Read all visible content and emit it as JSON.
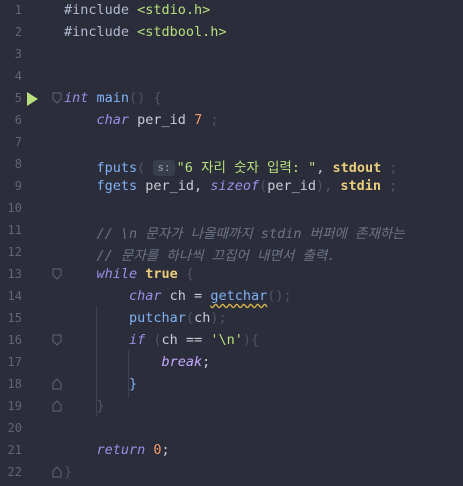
{
  "editor": {
    "lines": [
      {
        "n": "1",
        "parts": [
          {
            "t": "#include ",
            "c": "inc"
          },
          {
            "t": "<stdio.h>",
            "c": "str"
          }
        ]
      },
      {
        "n": "2",
        "parts": [
          {
            "t": "#include ",
            "c": "inc"
          },
          {
            "t": "<stdbool.h>",
            "c": "str"
          }
        ]
      },
      {
        "n": "3",
        "parts": []
      },
      {
        "n": "4",
        "parts": []
      },
      {
        "n": "5",
        "parts": [
          {
            "t": "int",
            "c": "kw"
          },
          {
            "t": " main",
            "c": "fn"
          },
          {
            "t": "() {",
            "c": "paren"
          }
        ]
      },
      {
        "n": "6",
        "parts": [
          {
            "t": "    char",
            "c": "kw"
          },
          {
            "t": " per_id ",
            "c": ""
          },
          {
            "t": "7",
            "c": "num"
          },
          {
            "t": " ;",
            "c": "paren"
          }
        ]
      },
      {
        "n": "7",
        "parts": []
      },
      {
        "n": "8",
        "parts": [
          {
            "t": "    fputs",
            "c": "fn"
          },
          {
            "t": "( ",
            "c": "paren"
          },
          {
            "t": "s:",
            "c": "hint"
          },
          {
            "t": "\"6 자리 숫자 입력: \"",
            "c": "str"
          },
          {
            "t": ", ",
            "c": ""
          },
          {
            "t": "stdout",
            "c": "bold"
          },
          {
            "t": " ;",
            "c": "paren"
          }
        ]
      },
      {
        "n": "9",
        "parts": [
          {
            "t": "    fgets",
            "c": "fn"
          },
          {
            "t": " per_id, ",
            "c": ""
          },
          {
            "t": "sizeof",
            "c": "kw"
          },
          {
            "t": "(",
            "c": "paren"
          },
          {
            "t": "per_id",
            "c": ""
          },
          {
            "t": "), ",
            "c": "paren"
          },
          {
            "t": "stdin",
            "c": "bold"
          },
          {
            "t": " ;",
            "c": "paren"
          }
        ]
      },
      {
        "n": "10",
        "parts": []
      },
      {
        "n": "11",
        "parts": [
          {
            "t": "    // \\n 문자가 나올때까지 stdin 버퍼에 존재하는",
            "c": "cmt"
          }
        ]
      },
      {
        "n": "12",
        "parts": [
          {
            "t": "    // 문자를 하나씩 끄집어 내면서 출력.",
            "c": "cmt"
          }
        ]
      },
      {
        "n": "13",
        "parts": [
          {
            "t": "    while",
            "c": "kw"
          },
          {
            "t": " true",
            "c": "bold"
          },
          {
            "t": " {",
            "c": "paren"
          }
        ]
      },
      {
        "n": "14",
        "parts": [
          {
            "t": "        char",
            "c": "kw"
          },
          {
            "t": " ch = ",
            "c": ""
          },
          {
            "t": "getchar",
            "c": "fn squiggle"
          },
          {
            "t": "();",
            "c": "paren"
          }
        ]
      },
      {
        "n": "15",
        "parts": [
          {
            "t": "        putchar",
            "c": "fn"
          },
          {
            "t": "(",
            "c": "paren"
          },
          {
            "t": "ch",
            "c": ""
          },
          {
            "t": ");",
            "c": "paren"
          }
        ]
      },
      {
        "n": "16",
        "parts": [
          {
            "t": "        if",
            "c": "kw"
          },
          {
            "t": " (",
            "c": "paren"
          },
          {
            "t": "ch ",
            "c": ""
          },
          {
            "t": "==",
            "c": ""
          },
          {
            "t": " '\\n'",
            "c": "str"
          },
          {
            "t": "){",
            "c": "paren"
          }
        ]
      },
      {
        "n": "17",
        "parts": [
          {
            "t": "            break",
            "c": "kwb"
          },
          {
            "t": ";",
            "c": ""
          }
        ]
      },
      {
        "n": "18",
        "parts": [
          {
            "t": "        }",
            "c": "fn"
          }
        ]
      },
      {
        "n": "19",
        "parts": [
          {
            "t": "    }",
            "c": "paren"
          }
        ]
      },
      {
        "n": "20",
        "parts": []
      },
      {
        "n": "21",
        "parts": [
          {
            "t": "    return",
            "c": "kw"
          },
          {
            "t": " 0",
            "c": "num"
          },
          {
            "t": ";",
            "c": ""
          }
        ]
      },
      {
        "n": "22",
        "parts": [
          {
            "t": "}",
            "c": "paren"
          }
        ]
      }
    ]
  },
  "colors": {
    "background": "#2b2d3a",
    "run_icon": "#b7e07d"
  },
  "icons": {
    "run": "run-arrow-icon",
    "fold": "fold-marker-icon"
  }
}
